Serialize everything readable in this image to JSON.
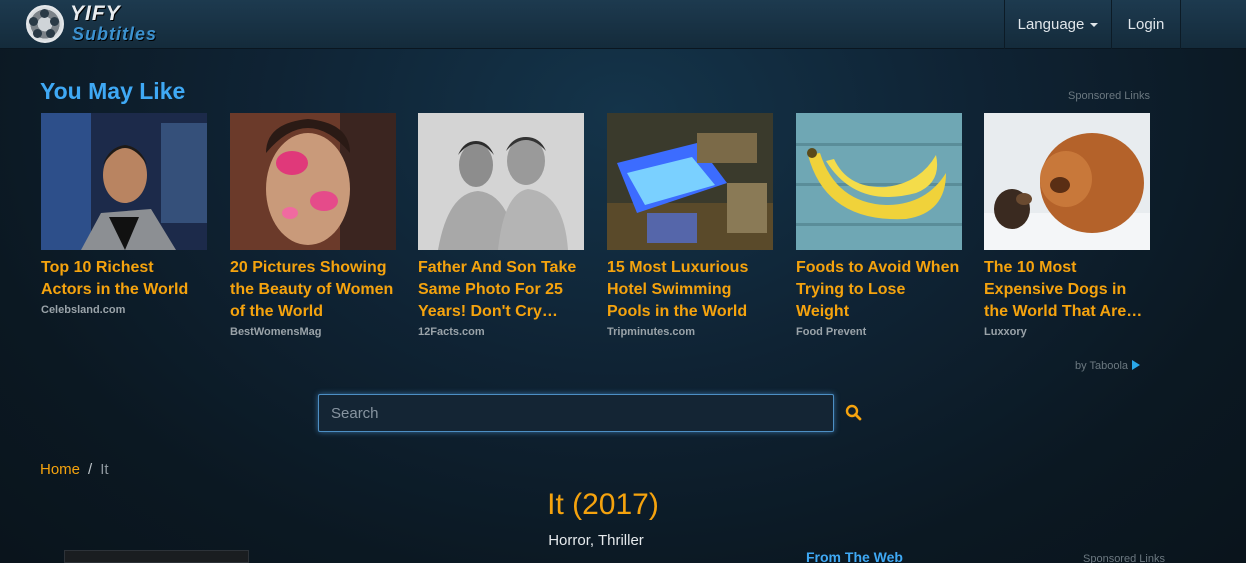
{
  "nav": {
    "logo_line1": "YIFY",
    "logo_line2": "Subtitles",
    "language_label": "Language",
    "login_label": "Login"
  },
  "recommendations": {
    "title": "You May Like",
    "sponsored_label": "Sponsored Links",
    "footer_label": "by Taboola",
    "items": [
      {
        "title": "Top 10 Richest Actors in the World",
        "source": "Celebsland.com"
      },
      {
        "title": "20 Pictures Showing the Beauty of Women of the World",
        "source": "BestWomensMag"
      },
      {
        "title": "Father And Son Take Same Photo For 25 Years! Don't Cry…",
        "source": "12Facts.com"
      },
      {
        "title": "15 Most Luxurious Hotel Swimming Pools in the World",
        "source": "Tripminutes.com"
      },
      {
        "title": "Foods to Avoid When Trying to Lose Weight",
        "source": "Food Prevent"
      },
      {
        "title": "The 10 Most Expensive Dogs in the World That Are…",
        "source": "Luxxory"
      }
    ]
  },
  "search": {
    "placeholder": "Search"
  },
  "breadcrumb": {
    "home": "Home",
    "separator": "/",
    "current": "It"
  },
  "movie": {
    "title": "It (2017)",
    "genres": "Horror, Thriller"
  },
  "sidebar": {
    "from_web_title": "From The Web",
    "sponsored_label": "Sponsored Links"
  },
  "colors": {
    "accent_orange": "#f5a30e",
    "accent_blue": "#3fa9f5",
    "background": "#0f2334"
  }
}
